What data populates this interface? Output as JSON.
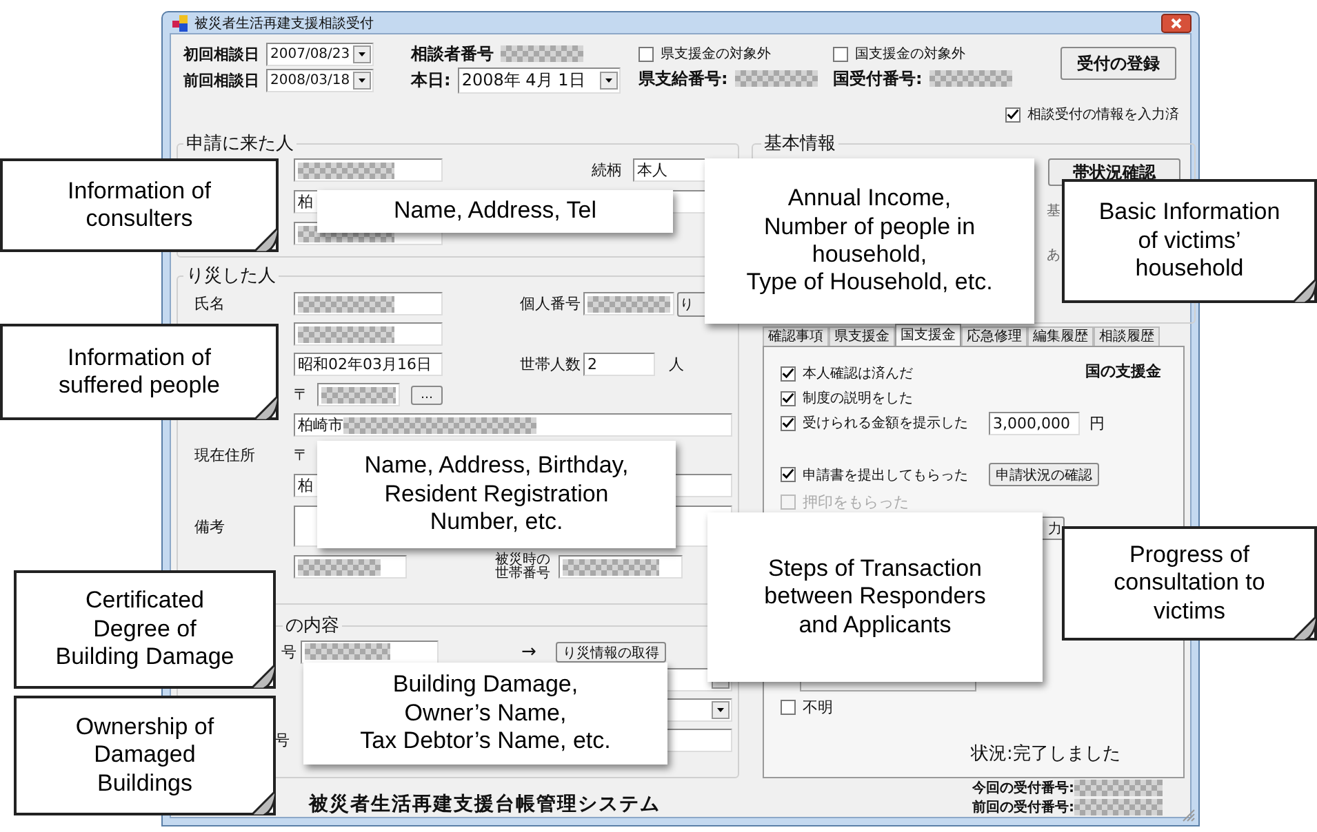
{
  "window": {
    "title": "被災者生活再建支援相談受付"
  },
  "header": {
    "first_date": {
      "label": "初回相談日",
      "value": "2007/08/23"
    },
    "prev_date": {
      "label": "前回相談日",
      "value": "2008/03/18"
    },
    "consulter_no": {
      "label": "相談者番号",
      "masked": true
    },
    "today": {
      "label": "本日:",
      "value": "2008年 4月 1日"
    },
    "exclusions": [
      {
        "label": "県支援金の対象外",
        "checked": false
      },
      {
        "label": "国支援金の対象外",
        "checked": false
      }
    ],
    "numbers": [
      {
        "label": "県支給番号:",
        "masked": true
      },
      {
        "label": "国受付番号:",
        "masked": true
      }
    ],
    "register_button": "受付の登録",
    "entered": {
      "label": "相談受付の情報を入力済",
      "checked": true
    }
  },
  "applicant": {
    "legend": "申請に来た人",
    "name": {
      "masked": true
    },
    "relation_label": "続柄",
    "relation": {
      "value": "本人"
    },
    "address": {
      "value": "柏"
    },
    "phone": {
      "masked": true
    }
  },
  "victim": {
    "legend": "り災した人",
    "name_label": "氏名",
    "name": {
      "masked": true
    },
    "id_label": "個人番号",
    "id": {
      "masked": true
    },
    "lookup_button": "り",
    "kana": {
      "masked": true
    },
    "birth": {
      "value": "昭和02年03月16日"
    },
    "household_label": "世帯人数",
    "household": {
      "value": "2"
    },
    "household_unit": "人",
    "postal_mark": "〒",
    "postal": {
      "masked": true
    },
    "postal_button": "…",
    "address": {
      "value": "柏崎市",
      "masked": true
    },
    "current_label": "現在住所",
    "current_postal_mark": "〒",
    "current_address": {
      "value": "柏"
    },
    "note_label": "備考",
    "current_household": {
      "masked": true
    },
    "disaster_household_label": [
      "被災時の",
      "世帯番号"
    ],
    "disaster_household": {
      "masked": true
    }
  },
  "damage": {
    "legend": "の内容",
    "number_label": "号",
    "number": {
      "masked": true
    },
    "arrow": "→",
    "fetch_button": "り災情報の取得",
    "owner_label": "号"
  },
  "footer_title": "被災者生活再建支援台帳管理システム",
  "basic_info": {
    "legend": "基本情報",
    "household_button": "帯状況確認",
    "fragments": [
      "基",
      "あ"
    ]
  },
  "tabs": [
    {
      "label": "確認事項",
      "selected": false
    },
    {
      "label": "県支援金",
      "selected": false
    },
    {
      "label": "国支援金",
      "selected": true
    },
    {
      "label": "応急修理",
      "selected": false
    },
    {
      "label": "編集履歴",
      "selected": false
    },
    {
      "label": "相談履歴",
      "selected": false
    }
  ],
  "support_panel": {
    "heading": "国の支援金",
    "checks": [
      {
        "label": "本人確認は済んだ",
        "checked": true
      },
      {
        "label": "制度の説明をした",
        "checked": true
      },
      {
        "label": "受けられる金額を提示した",
        "checked": true
      }
    ],
    "amount": "3,000,000",
    "currency": "円",
    "application": {
      "label": "申請書を提出してもらった",
      "checked": true
    },
    "status_button": "申請状況の確認",
    "seal": {
      "label": "押印をもらった",
      "checked": false,
      "disabled": true
    },
    "partial_button": "力",
    "unknown": {
      "label": "不明",
      "checked": false
    },
    "status": "状況:完了しました"
  },
  "receipts": [
    {
      "label": "今回の受付番号:",
      "masked": true
    },
    {
      "label": "前回の受付番号:",
      "masked": true
    }
  ],
  "callouts": [
    {
      "kind": "note",
      "text": "Information of\nconsulters"
    },
    {
      "kind": "box",
      "text": "Name, Address, Tel"
    },
    {
      "kind": "box",
      "text": "Annual Income,\nNumber of people in\nhousehold,\nType of Household, etc."
    },
    {
      "kind": "note",
      "text": "Basic Information\nof victims’\nhousehold"
    },
    {
      "kind": "note",
      "text": "Information of\nsuffered people"
    },
    {
      "kind": "box",
      "text": "Name, Address, Birthday,\nResident Registration\nNumber, etc."
    },
    {
      "kind": "box",
      "text": "Steps of Transaction\nbetween Responders\nand Applicants"
    },
    {
      "kind": "note",
      "text": "Progress of\nconsultation to\nvictims"
    },
    {
      "kind": "note",
      "text": "Certificated\nDegree of\nBuilding Damage"
    },
    {
      "kind": "box",
      "text": "Building Damage,\nOwner’s Name,\nTax Debtor’s Name, etc."
    },
    {
      "kind": "note",
      "text": "Ownership of\nDamaged\nBuildings"
    }
  ]
}
